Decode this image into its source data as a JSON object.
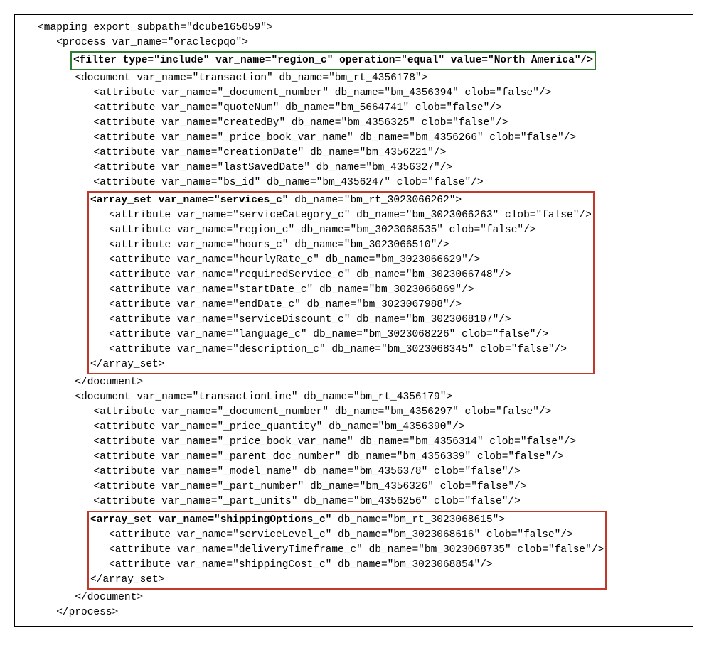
{
  "l1": "   <mapping export_subpath=\"dcube165059\">",
  "l2": "      <process var_name=\"oraclecpqo\">",
  "filterLine": "<filter type=\"include\" var_name=\"region_c\" operation=\"equal\" value=\"North America\"/>",
  "l4": "         <document var_name=\"transaction\" db_name=\"bm_rt_4356178\">",
  "l5": "            <attribute var_name=\"_document_number\" db_name=\"bm_4356394\" clob=\"false\"/>",
  "l6": "            <attribute var_name=\"quoteNum\" db_name=\"bm_5664741\" clob=\"false\"/>",
  "l7": "            <attribute var_name=\"createdBy\" db_name=\"bm_4356325\" clob=\"false\"/>",
  "l8": "            <attribute var_name=\"_price_book_var_name\" db_name=\"bm_4356266\" clob=\"false\"/>",
  "l9": "            <attribute var_name=\"creationDate\" db_name=\"bm_4356221\"/>",
  "l10": "            <attribute var_name=\"lastSavedDate\" db_name=\"bm_4356327\"/>",
  "l11": "            <attribute var_name=\"bs_id\" db_name=\"bm_4356247\" clob=\"false\"/>",
  "a1_open_bold": "<array_set var_name=\"services_c\"",
  "a1_open_rest": " db_name=\"bm_rt_3023066262\">",
  "a1_l1": "   <attribute var_name=\"serviceCategory_c\" db_name=\"bm_3023066263\" clob=\"false\"/>",
  "a1_l2": "   <attribute var_name=\"region_c\" db_name=\"bm_3023068535\" clob=\"false\"/>",
  "a1_l3": "   <attribute var_name=\"hours_c\" db_name=\"bm_3023066510\"/>",
  "a1_l4": "   <attribute var_name=\"hourlyRate_c\" db_name=\"bm_3023066629\"/>",
  "a1_l5": "   <attribute var_name=\"requiredService_c\" db_name=\"bm_3023066748\"/>",
  "a1_l6": "   <attribute var_name=\"startDate_c\" db_name=\"bm_3023066869\"/>",
  "a1_l7": "   <attribute var_name=\"endDate_c\" db_name=\"bm_3023067988\"/>",
  "a1_l8": "   <attribute var_name=\"serviceDiscount_c\" db_name=\"bm_3023068107\"/>",
  "a1_l9": "   <attribute var_name=\"language_c\" db_name=\"bm_3023068226\" clob=\"false\"/>",
  "a1_l10": "   <attribute var_name=\"description_c\" db_name=\"bm_3023068345\" clob=\"false\"/>",
  "a1_close": "</array_set>",
  "l12": "         </document>",
  "l13": "         <document var_name=\"transactionLine\" db_name=\"bm_rt_4356179\">",
  "l14": "            <attribute var_name=\"_document_number\" db_name=\"bm_4356297\" clob=\"false\"/>",
  "l15": "            <attribute var_name=\"_price_quantity\" db_name=\"bm_4356390\"/>",
  "l16": "            <attribute var_name=\"_price_book_var_name\" db_name=\"bm_4356314\" clob=\"false\"/>",
  "l17": "            <attribute var_name=\"_parent_doc_number\" db_name=\"bm_4356339\" clob=\"false\"/>",
  "l18": "            <attribute var_name=\"_model_name\" db_name=\"bm_4356378\" clob=\"false\"/>",
  "l19": "            <attribute var_name=\"_part_number\" db_name=\"bm_4356326\" clob=\"false\"/>",
  "l20": "            <attribute var_name=\"_part_units\" db_name=\"bm_4356256\" clob=\"false\"/>",
  "a2_open_bold": "<array_set var_name=\"shippingOptions_c\"",
  "a2_open_rest": " db_name=\"bm_rt_3023068615\">",
  "a2_l1": "   <attribute var_name=\"serviceLevel_c\" db_name=\"bm_3023068616\" clob=\"false\"/>",
  "a2_l2": "   <attribute var_name=\"deliveryTimeframe_c\" db_name=\"bm_3023068735\" clob=\"false\"/>",
  "a2_l3": "   <attribute var_name=\"shippingCost_c\" db_name=\"bm_3023068854\"/>",
  "a2_close": "</array_set>",
  "l21": "         </document>",
  "l22": "      </process>"
}
